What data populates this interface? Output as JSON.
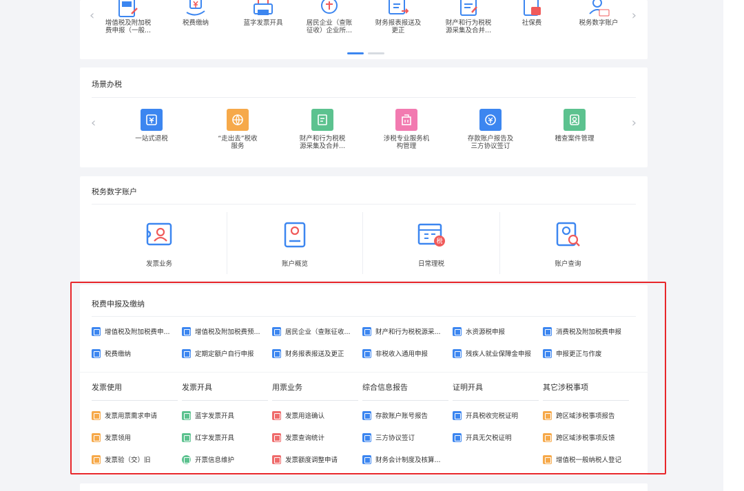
{
  "colors": {
    "blue": "#3c86f0",
    "orange": "#f6a94a",
    "green": "#5cc28f",
    "red_frame": "#e8262a"
  },
  "hot_services": {
    "items": [
      {
        "label": "增值税及附加税\n费申报（一般...",
        "icon": "add-tax-icon"
      },
      {
        "label": "税费缴纳",
        "icon": "hand-yuan-icon"
      },
      {
        "label": "蓝字发票开具",
        "icon": "invoice-printer-icon"
      },
      {
        "label": "居民企业（查账\n征收）企业所...",
        "icon": "enterprise-icon"
      },
      {
        "label": "财务报表报送及\n更正",
        "icon": "report-send-icon"
      },
      {
        "label": "财产和行为税税\n源采集及合并...",
        "icon": "property-tax-icon"
      },
      {
        "label": "社保费",
        "icon": "social-security-icon"
      },
      {
        "label": "税务数字账户",
        "icon": "digital-account-icon"
      }
    ],
    "prev": "‹",
    "next": "›"
  },
  "scene": {
    "title": "场景办税",
    "prev": "‹",
    "next": "›",
    "items": [
      {
        "label": "一站式退税",
        "color": "#3c86f0",
        "icon": "refund-icon"
      },
      {
        "label": "“走出去”税收\n服务",
        "color": "#f6a94a",
        "icon": "globe-tax-icon"
      },
      {
        "label": "财产和行为税税\n源采集及合并...",
        "color": "#5cc28f",
        "icon": "property-icon"
      },
      {
        "label": "涉税专业服务机\n构管理",
        "color": "#f27ab0",
        "icon": "building-icon"
      },
      {
        "label": "存款账户报告及\n三方协议签订",
        "color": "#3c86f0",
        "icon": "deposit-icon"
      },
      {
        "label": "稽查案件管理",
        "color": "#5cc28f",
        "icon": "inspection-icon"
      }
    ]
  },
  "account": {
    "title": "税务数字账户",
    "items": [
      {
        "label": "发票业务",
        "icon": "invoice-business-icon"
      },
      {
        "label": "账户概览",
        "icon": "account-overview-icon"
      },
      {
        "label": "日常理税",
        "icon": "daily-tax-icon",
        "badge": "税"
      },
      {
        "label": "账户查询",
        "icon": "account-query-icon"
      }
    ]
  },
  "declare": {
    "title": "税费申报及缴纳",
    "rows": [
      [
        "增值税及附加税费申...",
        "增值税及附加税费预...",
        "居民企业（查账征收...",
        "财产和行为税税源采...",
        "水资源税申报",
        "消费税及附加税费申报"
      ],
      [
        "税费缴纳",
        "定期定额户自行申报",
        "财务报表报送及更正",
        "非税收入通用申报",
        "残疾人就业保障金申报",
        "申报更正与作废"
      ]
    ],
    "categories": [
      {
        "head": "发票使用",
        "items": [
          "发票用票需求申请",
          "发票领用",
          "发票验（交）旧"
        ],
        "color": "#f6a94a"
      },
      {
        "head": "发票开具",
        "items": [
          "蓝字发票开具",
          "红字发票开具",
          "开票信息维护"
        ],
        "color": "#5cc28f"
      },
      {
        "head": "用票业务",
        "items": [
          "发票用途确认",
          "发票查询统计",
          "发票额度调整申请"
        ],
        "color": "#ef6b6b"
      },
      {
        "head": "综合信息报告",
        "items": [
          "存款账户账号报告",
          "三方协议签订",
          "财务会计制度及核算..."
        ],
        "color": "#3c86f0"
      },
      {
        "head": "证明开具",
        "items": [
          "开具税收完税证明",
          "开具无欠税证明"
        ],
        "color": "#3c86f0"
      },
      {
        "head": "其它涉税事项",
        "items": [
          "跨区域涉税事项报告",
          "跨区域涉税事项反馈",
          "增值税一般纳税人登记"
        ],
        "color": "#f6a94a"
      }
    ]
  }
}
